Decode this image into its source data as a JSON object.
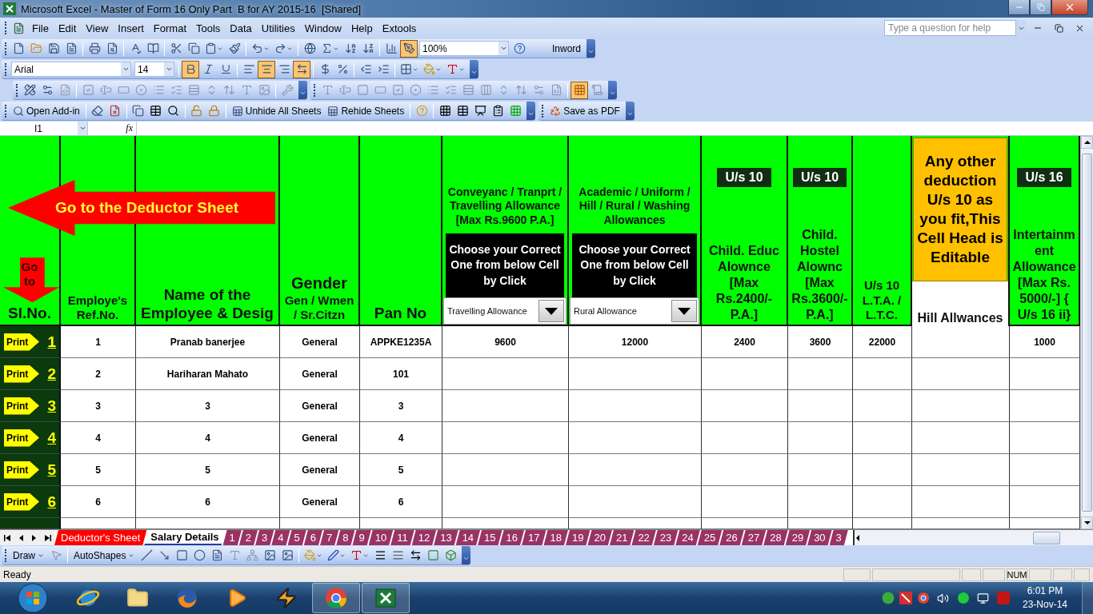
{
  "window": {
    "title": "Microsoft Excel - Master of Form 16 Only Part  B for AY 2015-16  [Shared]"
  },
  "menu": {
    "items": [
      "File",
      "Edit",
      "View",
      "Insert",
      "Format",
      "Tools",
      "Data",
      "Utilities",
      "Window",
      "Help",
      "Extools"
    ],
    "help_placeholder": "Type a question for help"
  },
  "standard_toolbar": {
    "drawing_pressed": true,
    "zoom": "100%",
    "inword": "Inword"
  },
  "formatting_toolbar": {
    "font": "Arial",
    "size": "14",
    "bold": true,
    "italic": false,
    "underline": false,
    "align_left": false,
    "align_center": true,
    "align_right": false,
    "merge": true
  },
  "controls_toolbar": {
    "grid_pressed": true
  },
  "addin_toolbar": {
    "open_addin": "Open Add-in",
    "unhide": "Unhide All Sheets",
    "rehide": "Rehide Sheets",
    "save_pdf": "Save as PDF"
  },
  "formula_bar": {
    "name_box": "I1",
    "fx": "fx"
  },
  "sheet": {
    "deductor_link": "Go to the Deductor Sheet",
    "row_header": {
      "label": "Sl.No.",
      "goto": "Go to"
    },
    "columns": [
      {
        "kind": "plain",
        "label": "Employe's Ref.No."
      },
      {
        "kind": "title",
        "label": "Name of the Employee & Desig"
      },
      {
        "kind": "gender",
        "title": "Gender",
        "label": "Gen / Wmen / Sr.Citzn"
      },
      {
        "kind": "title",
        "label": "Pan No"
      },
      {
        "kind": "choice",
        "label": "Conveyanc / Tranprt / Travelling Allowance [Max Rs.9600 P.A.]",
        "note": "Choose your Correct One from below Cell by Click",
        "current_choice": "Travelling Allowance"
      },
      {
        "kind": "choice",
        "label": "Academic / Uniform / Hill / Rural / Washing Allowances",
        "note": "Choose your Correct One from below Cell by Click",
        "current_choice": "Rural Allowance"
      },
      {
        "kind": "section",
        "badge": "U/s 10",
        "label": "Child. Educ Alownce [Max Rs.2400/- P.A.]"
      },
      {
        "kind": "section",
        "badge": "U/s 10",
        "label": "Child. Hostel Alownc [Max Rs.3600/- P.A.]"
      },
      {
        "kind": "plain",
        "label": "U/s 10 L.T.A. / L.T.C."
      },
      {
        "kind": "editable",
        "note": "Any other deduction U/s 10 as you fit,This Cell Head is Editable",
        "label": "Hill Allwances"
      },
      {
        "kind": "section",
        "badge": "U/s 16",
        "label": "Intertainment Allowance [Max Rs. 5000/-] { U/s 16 ii}"
      }
    ],
    "rows": [
      {
        "print": "Print",
        "no": "1",
        "cells": [
          "1",
          "Pranab banerjee",
          "General",
          "APPKE1235A",
          "9600",
          "12000",
          "2400",
          "3600",
          "22000",
          null,
          "1000"
        ]
      },
      {
        "print": "Print",
        "no": "2",
        "cells": [
          "2",
          "Hariharan Mahato",
          "General",
          "101",
          null,
          null,
          null,
          null,
          null,
          null,
          null
        ]
      },
      {
        "print": "Print",
        "no": "3",
        "cells": [
          "3",
          "3",
          "General",
          "3",
          null,
          null,
          null,
          null,
          null,
          null,
          null
        ]
      },
      {
        "print": "Print",
        "no": "4",
        "cells": [
          "4",
          "4",
          "General",
          "4",
          null,
          null,
          null,
          null,
          null,
          null,
          null
        ]
      },
      {
        "print": "Print",
        "no": "5",
        "cells": [
          "5",
          "5",
          "General",
          "5",
          null,
          null,
          null,
          null,
          null,
          null,
          null
        ]
      },
      {
        "print": "Print",
        "no": "6",
        "cells": [
          "6",
          "6",
          "General",
          "6",
          null,
          null,
          null,
          null,
          null,
          null,
          null
        ]
      }
    ]
  },
  "sheet_tabs": [
    {
      "label": "Deductor's Sheet",
      "selected": false,
      "color": "#ff0000"
    },
    {
      "label": "Salary Details",
      "selected": true,
      "color": "#ffffff"
    },
    {
      "label": "1",
      "selected": false,
      "color": "#993366"
    },
    {
      "label": "2",
      "selected": false,
      "color": "#993366"
    },
    {
      "label": "3",
      "selected": false,
      "color": "#993366"
    },
    {
      "label": "4",
      "selected": false,
      "color": "#993366"
    },
    {
      "label": "5",
      "selected": false,
      "color": "#993366"
    },
    {
      "label": "6",
      "selected": false,
      "color": "#993366"
    },
    {
      "label": "7",
      "selected": false,
      "color": "#993366"
    },
    {
      "label": "8",
      "selected": false,
      "color": "#993366"
    },
    {
      "label": "9",
      "selected": false,
      "color": "#993366"
    },
    {
      "label": "10",
      "selected": false,
      "color": "#993366"
    },
    {
      "label": "11",
      "selected": false,
      "color": "#993366"
    },
    {
      "label": "12",
      "selected": false,
      "color": "#993366"
    },
    {
      "label": "13",
      "selected": false,
      "color": "#993366"
    },
    {
      "label": "14",
      "selected": false,
      "color": "#993366"
    },
    {
      "label": "15",
      "selected": false,
      "color": "#993366"
    },
    {
      "label": "16",
      "selected": false,
      "color": "#993366"
    },
    {
      "label": "17",
      "selected": false,
      "color": "#993366"
    },
    {
      "label": "18",
      "selected": false,
      "color": "#993366"
    },
    {
      "label": "19",
      "selected": false,
      "color": "#993366"
    },
    {
      "label": "20",
      "selected": false,
      "color": "#993366"
    },
    {
      "label": "21",
      "selected": false,
      "color": "#993366"
    },
    {
      "label": "22",
      "selected": false,
      "color": "#993366"
    },
    {
      "label": "23",
      "selected": false,
      "color": "#993366"
    },
    {
      "label": "24",
      "selected": false,
      "color": "#993366"
    },
    {
      "label": "25",
      "selected": false,
      "color": "#993366"
    },
    {
      "label": "26",
      "selected": false,
      "color": "#993366"
    },
    {
      "label": "27",
      "selected": false,
      "color": "#993366"
    },
    {
      "label": "28",
      "selected": false,
      "color": "#993366"
    },
    {
      "label": "29",
      "selected": false,
      "color": "#993366"
    },
    {
      "label": "30",
      "selected": false,
      "color": "#993366"
    },
    {
      "label": "3",
      "selected": false,
      "color": "#993366"
    }
  ],
  "drawing_toolbar": {
    "draw": "Draw",
    "autoshapes": "AutoShapes"
  },
  "status_bar": {
    "text": "Ready",
    "indicator": "NUM"
  },
  "taskbar": {
    "apps": [
      {
        "running": false
      },
      {
        "running": false
      },
      {
        "running": false
      },
      {
        "running": false
      },
      {
        "running": false
      },
      {
        "running": true
      },
      {
        "running": true
      }
    ],
    "time": "6:01 PM",
    "date": "23-Nov-14"
  }
}
